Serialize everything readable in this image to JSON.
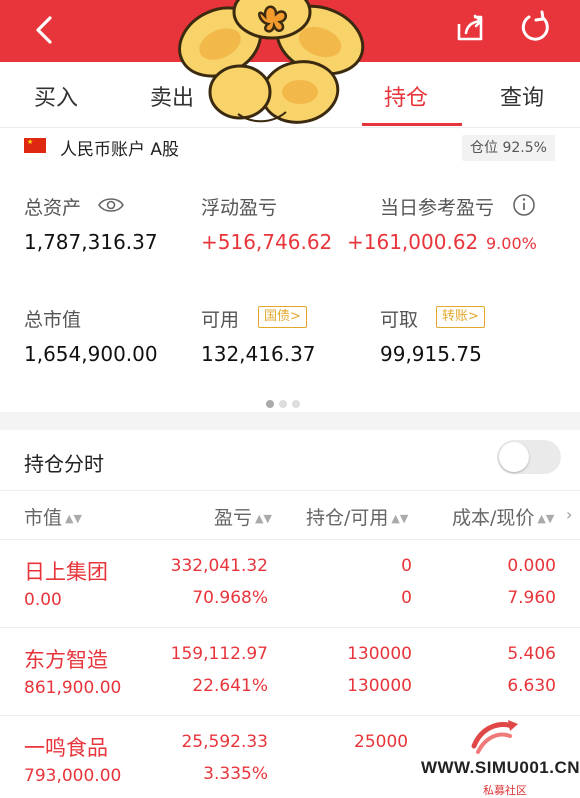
{
  "tabs": [
    {
      "label": "买入"
    },
    {
      "label": "卖出"
    },
    {
      "label": "持仓"
    },
    {
      "label": "查询"
    }
  ],
  "account": {
    "label": "人民币账户 A股",
    "position_badge": "仓位 92.5%"
  },
  "stats": {
    "total_assets_label": "总资产",
    "total_assets": "1,787,316.37",
    "floating_pl_label": "浮动盈亏",
    "floating_pl": "+516,746.62",
    "today_pl_label": "当日参考盈亏",
    "today_pl": "+161,000.62",
    "today_pl_pct": "9.00%",
    "market_value_label": "总市值",
    "market_value": "1,654,900.00",
    "available_label": "可用",
    "available": "132,416.37",
    "available_tag": "国债>",
    "withdrawable_label": "可取",
    "withdrawable": "99,915.75",
    "withdrawable_tag": "转账>"
  },
  "split_label": "持仓分时",
  "columns": {
    "market_value": "市值",
    "pl": "盈亏",
    "holding": "持仓/可用",
    "cost": "成本/现价"
  },
  "holdings": [
    {
      "name": "日上集团",
      "market_value": "0.00",
      "pl": "332,041.32",
      "pl_pct": "70.968%",
      "holding": "0",
      "available": "0",
      "cost": "0.000",
      "price": "7.960"
    },
    {
      "name": "东方智造",
      "market_value": "861,900.00",
      "pl": "159,112.97",
      "pl_pct": "22.641%",
      "holding": "130000",
      "available": "130000",
      "cost": "5.406",
      "price": "6.630"
    },
    {
      "name": "一鸣食品",
      "market_value": "793,000.00",
      "pl": "25,592.33",
      "pl_pct": "3.335%",
      "holding": "25000",
      "available": "",
      "cost": "",
      "price": ""
    }
  ],
  "watermark": {
    "text": "WWW.SIMU001.CN",
    "sub": "私募社区"
  },
  "colors": {
    "accent": "#e8353b",
    "tag": "#e3a82b"
  }
}
